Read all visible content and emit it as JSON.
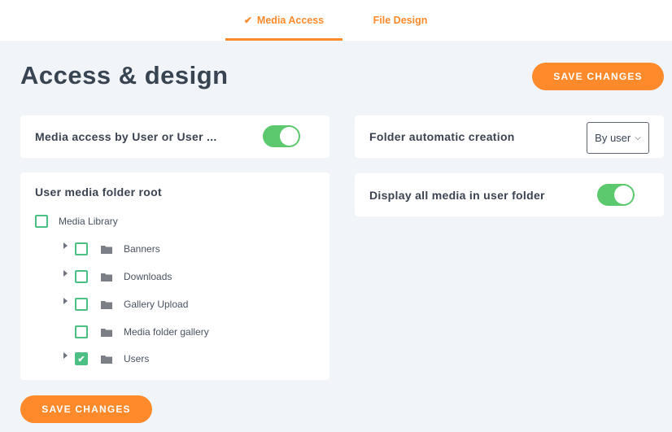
{
  "tabs": [
    {
      "label": "Media Access",
      "active": true,
      "icon": "check-icon"
    },
    {
      "label": "File Design",
      "active": false
    }
  ],
  "page_title": "Access & design",
  "save_button_label": "SAVE CHANGES",
  "settings": {
    "media_access": {
      "label": "Media access by User or User ...",
      "enabled": true
    },
    "folder_root": {
      "label": "User media folder root",
      "root": {
        "label": "Media Library",
        "checked": false
      },
      "children": [
        {
          "label": "Banners",
          "checked": false,
          "expandable": true
        },
        {
          "label": "Downloads",
          "checked": false,
          "expandable": true
        },
        {
          "label": "Gallery Upload",
          "checked": false,
          "expandable": true
        },
        {
          "label": "Media folder gallery",
          "checked": false,
          "expandable": false
        },
        {
          "label": "Users",
          "checked": true,
          "expandable": true
        }
      ]
    },
    "folder_creation": {
      "label": "Folder automatic creation",
      "value": "By user"
    },
    "display_all_media": {
      "label": "Display all media in user folder",
      "enabled": true
    }
  },
  "colors": {
    "accent": "#ff8a2b",
    "toggle_on": "#5cc96e",
    "checkbox": "#4bbf84"
  }
}
